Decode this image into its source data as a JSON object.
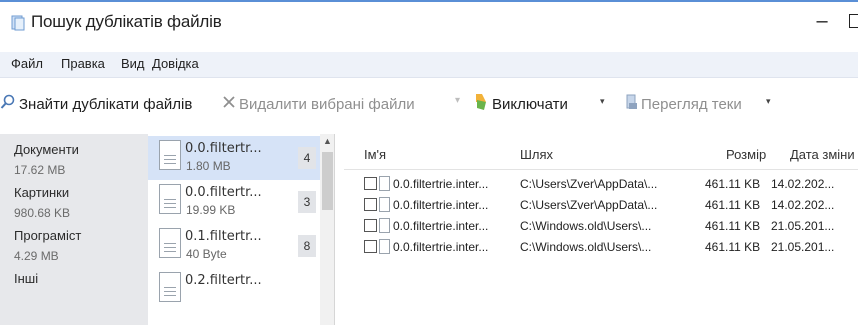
{
  "window": {
    "title": "Пошук дублікатів файлів",
    "minimize_glyph": "–"
  },
  "menu": [
    "Файл",
    "Правка",
    "Вид",
    "Довідка"
  ],
  "toolbar": {
    "find_label": "Знайти дублікати файлів",
    "delete_label": "Видалити вибрані файли",
    "exclude_label": "Виключати",
    "browse_label": "Перегляд теки",
    "dropdown_glyph": "▾",
    "more_glyph": "▾"
  },
  "categories": [
    {
      "name": "Документи",
      "size": "17.62 MB"
    },
    {
      "name": "Картинки",
      "size": "980.68 KB"
    },
    {
      "name": "Програміст",
      "size": "4.29 MB"
    },
    {
      "name": "Інші",
      "size": ""
    }
  ],
  "groups": [
    {
      "name": "0.0.filtertr...",
      "size": "1.80 MB",
      "count": "4"
    },
    {
      "name": "0.0.filtertr...",
      "size": "19.99 KB",
      "count": "3"
    },
    {
      "name": "0.1.filtertr...",
      "size": "40 Byte",
      "count": "8"
    },
    {
      "name": "0.2.filtertr...",
      "size": "",
      "count": ""
    }
  ],
  "table": {
    "columns": {
      "name": "Ім'я",
      "path": "Шлях",
      "size": "Розмір",
      "date": "Дата зміни"
    },
    "rows": [
      {
        "name": "0.0.filtertrie.inter...",
        "path": "C:\\Users\\Zver\\AppData\\...",
        "size": "461.11 KB",
        "date": "14.02.202..."
      },
      {
        "name": "0.0.filtertrie.inter...",
        "path": "C:\\Users\\Zver\\AppData\\...",
        "size": "461.11 KB",
        "date": "14.02.202..."
      },
      {
        "name": "0.0.filtertrie.inter...",
        "path": "C:\\Windows.old\\Users\\...",
        "size": "461.11 KB",
        "date": "21.05.201..."
      },
      {
        "name": "0.0.filtertrie.inter...",
        "path": "C:\\Windows.old\\Users\\...",
        "size": "461.11 KB",
        "date": "21.05.201..."
      }
    ]
  },
  "colors": {
    "accent_blue": "#5a8fd6",
    "selected_row": "#d6e3f7",
    "category_bg": "#e7e8eb",
    "exclude_icon_orange": "#e8a21e"
  }
}
